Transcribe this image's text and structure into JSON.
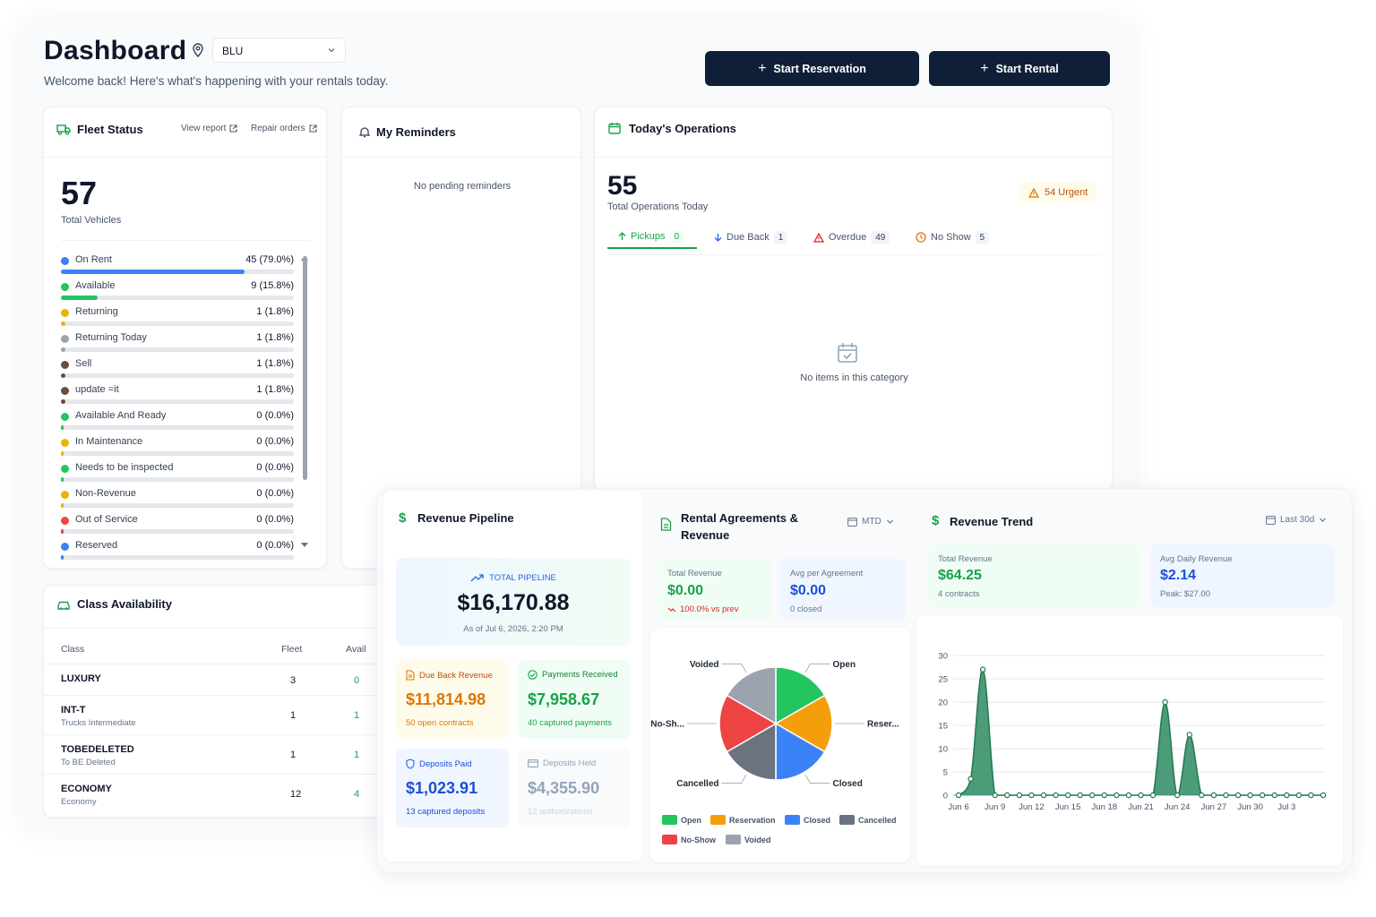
{
  "header": {
    "title": "Dashboard",
    "location": "BLU",
    "welcome": "Welcome back! Here's what's happening with your rentals today.",
    "start_reservation": "Start Reservation",
    "start_rental": "Start Rental"
  },
  "fleet": {
    "title": "Fleet Status",
    "view_report": "View report",
    "repair_orders": "Repair orders",
    "total": "57",
    "total_label": "Total Vehicles",
    "rows": [
      {
        "label": "On Rent",
        "value": "45 (79.0%)",
        "pct": 79.0,
        "color": "#3b82f6"
      },
      {
        "label": "Available",
        "value": "9 (15.8%)",
        "pct": 15.8,
        "color": "#22c55e"
      },
      {
        "label": "Returning",
        "value": "1 (1.8%)",
        "pct": 1.8,
        "color": "#eab308"
      },
      {
        "label": "Returning Today",
        "value": "1 (1.8%)",
        "pct": 1.8,
        "color": "#9ca3af"
      },
      {
        "label": "Sell",
        "value": "1 (1.8%)",
        "pct": 1.8,
        "color": "#6b4e3d"
      },
      {
        "label": "update =it",
        "value": "1 (1.8%)",
        "pct": 1.8,
        "color": "#6b4e3d"
      },
      {
        "label": "Available And Ready",
        "value": "0 (0.0%)",
        "pct": 0,
        "color": "#22c55e"
      },
      {
        "label": "In Maintenance",
        "value": "0 (0.0%)",
        "pct": 0,
        "color": "#eab308"
      },
      {
        "label": "Needs to be inspected",
        "value": "0 (0.0%)",
        "pct": 0,
        "color": "#22c55e"
      },
      {
        "label": "Non-Revenue",
        "value": "0 (0.0%)",
        "pct": 0,
        "color": "#eab308"
      },
      {
        "label": "Out of Service",
        "value": "0 (0.0%)",
        "pct": 0,
        "color": "#ef4444"
      },
      {
        "label": "Reserved",
        "value": "0 (0.0%)",
        "pct": 0,
        "color": "#3b82f6"
      }
    ]
  },
  "reminders": {
    "title": "My Reminders",
    "empty": "No pending reminders"
  },
  "operations": {
    "title": "Today's Operations",
    "total": "55",
    "total_label": "Total Operations Today",
    "urgent": "54 Urgent",
    "tabs": [
      {
        "label": "Pickups",
        "count": "0"
      },
      {
        "label": "Due Back",
        "count": "1"
      },
      {
        "label": "Overdue",
        "count": "49"
      },
      {
        "label": "No Show",
        "count": "5"
      }
    ],
    "empty": "No items in this category"
  },
  "classes": {
    "title": "Class Availability",
    "col_class": "Class",
    "col_fleet": "Fleet",
    "col_avail": "Avail",
    "rows": [
      {
        "name": "LUXURY",
        "sub": "",
        "fleet": "3",
        "avail": "0"
      },
      {
        "name": "INT-T",
        "sub": "Trucks Intermediate",
        "fleet": "1",
        "avail": "1"
      },
      {
        "name": "TOBEDELETED",
        "sub": "To BE Deleted",
        "fleet": "1",
        "avail": "1"
      },
      {
        "name": "ECONOMY",
        "sub": "Economy",
        "fleet": "12",
        "avail": "4"
      }
    ]
  },
  "pipeline": {
    "title": "Revenue Pipeline",
    "total_label": "TOTAL PIPELINE",
    "total": "$16,170.88",
    "as_of": "As of Jul 6, 2026, 2:20 PM",
    "due_back": {
      "label": "Due Back Revenue",
      "value": "$11,814.98",
      "sub": "50 open contracts"
    },
    "payments": {
      "label": "Payments Received",
      "value": "$7,958.67",
      "sub": "40 captured payments"
    },
    "deposits_paid": {
      "label": "Deposits Paid",
      "value": "$1,023.91",
      "sub": "13 captured deposits"
    },
    "deposits_held": {
      "label": "Deposits Held",
      "value": "$4,355.90",
      "sub": "12 authorizations"
    }
  },
  "agreements": {
    "title_line1": "Rental Agreements &",
    "title_line2": "Revenue",
    "period": "MTD",
    "total_revenue_label": "Total Revenue",
    "total_revenue": "$0.00",
    "change": "100.0% vs prev",
    "avg_label": "Avg per Agreement",
    "avg": "$0.00",
    "avg_sub": "0 closed"
  },
  "trend": {
    "title": "Revenue Trend",
    "period": "Last 30d",
    "total_label": "Total Revenue",
    "total": "$64.25",
    "total_sub": "4 contracts",
    "avg_label": "Avg Daily Revenue",
    "avg": "$2.14",
    "peak": "Peak: $27.00"
  },
  "chart_data": [
    {
      "type": "pie",
      "labels": [
        "Open",
        "Reser...",
        "Closed",
        "Cancelled",
        "No-Sh...",
        "Voided"
      ],
      "values": [
        1,
        1,
        1,
        1,
        1,
        1
      ],
      "colors": [
        "#22c55e",
        "#f59e0b",
        "#3b82f6",
        "#6b7280",
        "#ef4444",
        "#9ca3af"
      ],
      "legend": [
        "Open",
        "Reservation",
        "Closed",
        "Cancelled",
        "No-Show",
        "Voided"
      ],
      "legend_position": "bottom"
    },
    {
      "type": "area",
      "x": [
        "Jun 6",
        "Jun 7",
        "Jun 8",
        "Jun 9",
        "Jun 10",
        "Jun 11",
        "Jun 12",
        "Jun 13",
        "Jun 14",
        "Jun 15",
        "Jun 16",
        "Jun 17",
        "Jun 18",
        "Jun 19",
        "Jun 20",
        "Jun 21",
        "Jun 22",
        "Jun 23",
        "Jun 24",
        "Jun 25",
        "Jun 26",
        "Jun 27",
        "Jun 28",
        "Jun 29",
        "Jun 30",
        "Jul 1",
        "Jul 2",
        "Jul 3",
        "Jul 4",
        "Jul 5",
        "Jul 6"
      ],
      "values": [
        0,
        3.5,
        27,
        0,
        0,
        0,
        0,
        0,
        0,
        0,
        0,
        0,
        0,
        0,
        0,
        0,
        0,
        20,
        0,
        13,
        0,
        0,
        0,
        0,
        0,
        0,
        0,
        0,
        0,
        0,
        0
      ],
      "xticks": [
        "Jun 6",
        "Jun 9",
        "Jun 12",
        "Jun 15",
        "Jun 18",
        "Jun 21",
        "Jun 24",
        "Jun 27",
        "Jun 30",
        "Jul 3"
      ],
      "yticks": [
        0,
        5,
        10,
        15,
        20,
        25,
        30
      ],
      "ylim": [
        0,
        30
      ],
      "grid": true,
      "color": "#2e8b61"
    }
  ]
}
